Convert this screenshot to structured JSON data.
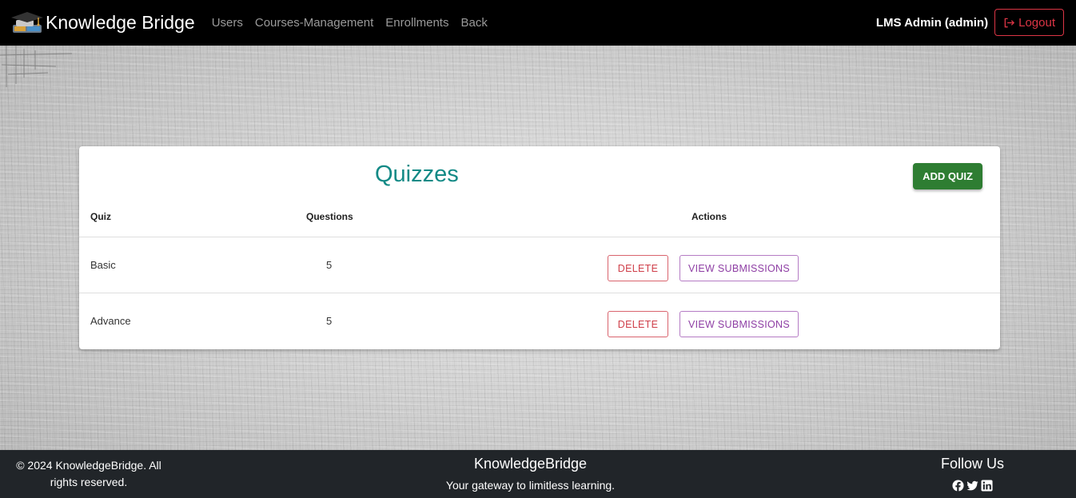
{
  "navbar": {
    "brand": "Knowledge Bridge",
    "links": [
      "Users",
      "Courses-Management",
      "Enrollments",
      "Back"
    ],
    "user": "LMS Admin (admin)",
    "logout_label": "Logout"
  },
  "quizzes": {
    "title": "Quizzes",
    "add_button": "ADD QUIZ",
    "headers": {
      "quiz": "Quiz",
      "questions": "Questions",
      "actions": "Actions"
    },
    "rows": [
      {
        "quiz": "Basic",
        "questions": "5",
        "delete": "DELETE",
        "view": "VIEW SUBMISSIONS"
      },
      {
        "quiz": "Advance",
        "questions": "5",
        "delete": "DELETE",
        "view": "VIEW SUBMISSIONS"
      }
    ]
  },
  "footer": {
    "copyright": "© 2024 KnowledgeBridge. All rights reserved.",
    "brand": "KnowledgeBridge",
    "tagline": "Your gateway to limitless learning.",
    "follow_title": "Follow Us",
    "social_icons": [
      "facebook-icon",
      "twitter-icon",
      "linkedin-icon"
    ]
  },
  "colors": {
    "navbar_bg": "#000000",
    "title_teal": "#138a86",
    "add_green": "#2e7d32",
    "delete_red": "#cf3f4a",
    "view_purple": "#8e3ea4",
    "logout_red": "#dc3545",
    "footer_bg": "#212529"
  }
}
